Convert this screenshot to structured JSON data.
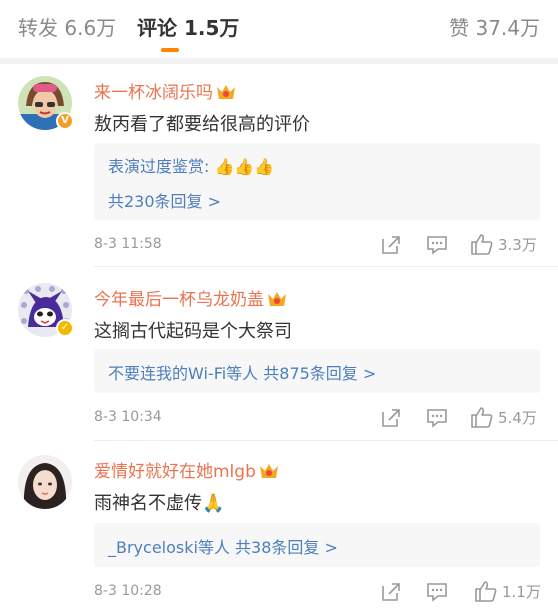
{
  "tabs": {
    "repost": "转发 6.6万",
    "comments": "评论 1.5万",
    "likes": "赞 37.4万"
  },
  "comments": [
    {
      "username": "来一杯冰阔乐吗",
      "text": "敖丙看了都要给很高的评价",
      "reply_line1": "表演过度鉴赏:",
      "reply_emoji": "👍👍👍",
      "reply_line2": "共230条回复 >",
      "time": "8-3 11:58",
      "likes": "3.3万"
    },
    {
      "username": "今年最后一杯乌龙奶盖",
      "text": "这搁古代起码是个大祭司",
      "reply_line1": "不要连我的Wi-Fi等人  共875条回复 >",
      "time": "8-3 10:34",
      "likes": "5.4万"
    },
    {
      "username": "爱情好就好在她mlgb",
      "text": "雨神名不虚传",
      "text_emoji": "🙏",
      "reply_line1": "_Bryceloski等人  共38条回复 >",
      "time": "8-3 10:28",
      "likes": "1.1万"
    }
  ],
  "colors": {
    "accent": "#ff8200",
    "username": "#eb7350",
    "link": "#4d7fbd",
    "meta": "#999999"
  }
}
